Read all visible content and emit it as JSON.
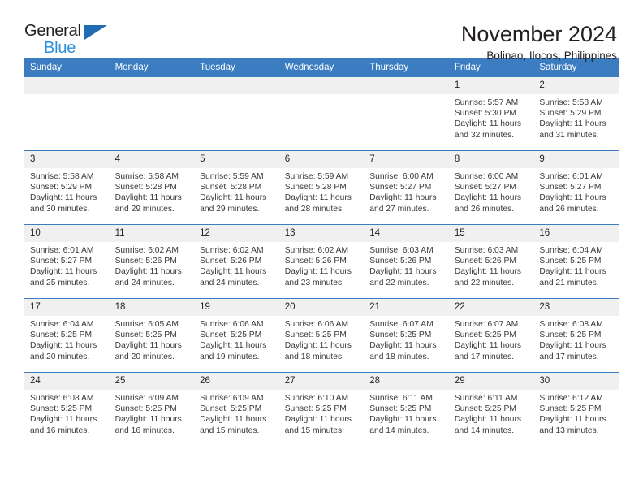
{
  "logo": {
    "line1": "General",
    "line2": "Blue",
    "triangle_icon": "logo-triangle-icon"
  },
  "header": {
    "title": "November 2024",
    "subtitle": "Bolinao, Ilocos, Philippines"
  },
  "colors": {
    "header_blue": "#3b7dc0",
    "logo_blue": "#2e8fd8",
    "daynum_bg": "#f0f0f0",
    "text": "#231f20"
  },
  "labels": {
    "sunrise": "Sunrise:",
    "sunset": "Sunset:",
    "daylight": "Daylight:"
  },
  "weekdays": [
    "Sunday",
    "Monday",
    "Tuesday",
    "Wednesday",
    "Thursday",
    "Friday",
    "Saturday"
  ],
  "weeks": [
    [
      {
        "day": "",
        "empty": true
      },
      {
        "day": "",
        "empty": true
      },
      {
        "day": "",
        "empty": true
      },
      {
        "day": "",
        "empty": true
      },
      {
        "day": "",
        "empty": true
      },
      {
        "day": "1",
        "sunrise": "Sunrise: 5:57 AM",
        "sunset": "Sunset: 5:30 PM",
        "daylight_1": "Daylight: 11 hours",
        "daylight_2": "and 32 minutes."
      },
      {
        "day": "2",
        "sunrise": "Sunrise: 5:58 AM",
        "sunset": "Sunset: 5:29 PM",
        "daylight_1": "Daylight: 11 hours",
        "daylight_2": "and 31 minutes."
      }
    ],
    [
      {
        "day": "3",
        "sunrise": "Sunrise: 5:58 AM",
        "sunset": "Sunset: 5:29 PM",
        "daylight_1": "Daylight: 11 hours",
        "daylight_2": "and 30 minutes."
      },
      {
        "day": "4",
        "sunrise": "Sunrise: 5:58 AM",
        "sunset": "Sunset: 5:28 PM",
        "daylight_1": "Daylight: 11 hours",
        "daylight_2": "and 29 minutes."
      },
      {
        "day": "5",
        "sunrise": "Sunrise: 5:59 AM",
        "sunset": "Sunset: 5:28 PM",
        "daylight_1": "Daylight: 11 hours",
        "daylight_2": "and 29 minutes."
      },
      {
        "day": "6",
        "sunrise": "Sunrise: 5:59 AM",
        "sunset": "Sunset: 5:28 PM",
        "daylight_1": "Daylight: 11 hours",
        "daylight_2": "and 28 minutes."
      },
      {
        "day": "7",
        "sunrise": "Sunrise: 6:00 AM",
        "sunset": "Sunset: 5:27 PM",
        "daylight_1": "Daylight: 11 hours",
        "daylight_2": "and 27 minutes."
      },
      {
        "day": "8",
        "sunrise": "Sunrise: 6:00 AM",
        "sunset": "Sunset: 5:27 PM",
        "daylight_1": "Daylight: 11 hours",
        "daylight_2": "and 26 minutes."
      },
      {
        "day": "9",
        "sunrise": "Sunrise: 6:01 AM",
        "sunset": "Sunset: 5:27 PM",
        "daylight_1": "Daylight: 11 hours",
        "daylight_2": "and 26 minutes."
      }
    ],
    [
      {
        "day": "10",
        "sunrise": "Sunrise: 6:01 AM",
        "sunset": "Sunset: 5:27 PM",
        "daylight_1": "Daylight: 11 hours",
        "daylight_2": "and 25 minutes."
      },
      {
        "day": "11",
        "sunrise": "Sunrise: 6:02 AM",
        "sunset": "Sunset: 5:26 PM",
        "daylight_1": "Daylight: 11 hours",
        "daylight_2": "and 24 minutes."
      },
      {
        "day": "12",
        "sunrise": "Sunrise: 6:02 AM",
        "sunset": "Sunset: 5:26 PM",
        "daylight_1": "Daylight: 11 hours",
        "daylight_2": "and 24 minutes."
      },
      {
        "day": "13",
        "sunrise": "Sunrise: 6:02 AM",
        "sunset": "Sunset: 5:26 PM",
        "daylight_1": "Daylight: 11 hours",
        "daylight_2": "and 23 minutes."
      },
      {
        "day": "14",
        "sunrise": "Sunrise: 6:03 AM",
        "sunset": "Sunset: 5:26 PM",
        "daylight_1": "Daylight: 11 hours",
        "daylight_2": "and 22 minutes."
      },
      {
        "day": "15",
        "sunrise": "Sunrise: 6:03 AM",
        "sunset": "Sunset: 5:26 PM",
        "daylight_1": "Daylight: 11 hours",
        "daylight_2": "and 22 minutes."
      },
      {
        "day": "16",
        "sunrise": "Sunrise: 6:04 AM",
        "sunset": "Sunset: 5:25 PM",
        "daylight_1": "Daylight: 11 hours",
        "daylight_2": "and 21 minutes."
      }
    ],
    [
      {
        "day": "17",
        "sunrise": "Sunrise: 6:04 AM",
        "sunset": "Sunset: 5:25 PM",
        "daylight_1": "Daylight: 11 hours",
        "daylight_2": "and 20 minutes."
      },
      {
        "day": "18",
        "sunrise": "Sunrise: 6:05 AM",
        "sunset": "Sunset: 5:25 PM",
        "daylight_1": "Daylight: 11 hours",
        "daylight_2": "and 20 minutes."
      },
      {
        "day": "19",
        "sunrise": "Sunrise: 6:06 AM",
        "sunset": "Sunset: 5:25 PM",
        "daylight_1": "Daylight: 11 hours",
        "daylight_2": "and 19 minutes."
      },
      {
        "day": "20",
        "sunrise": "Sunrise: 6:06 AM",
        "sunset": "Sunset: 5:25 PM",
        "daylight_1": "Daylight: 11 hours",
        "daylight_2": "and 18 minutes."
      },
      {
        "day": "21",
        "sunrise": "Sunrise: 6:07 AM",
        "sunset": "Sunset: 5:25 PM",
        "daylight_1": "Daylight: 11 hours",
        "daylight_2": "and 18 minutes."
      },
      {
        "day": "22",
        "sunrise": "Sunrise: 6:07 AM",
        "sunset": "Sunset: 5:25 PM",
        "daylight_1": "Daylight: 11 hours",
        "daylight_2": "and 17 minutes."
      },
      {
        "day": "23",
        "sunrise": "Sunrise: 6:08 AM",
        "sunset": "Sunset: 5:25 PM",
        "daylight_1": "Daylight: 11 hours",
        "daylight_2": "and 17 minutes."
      }
    ],
    [
      {
        "day": "24",
        "sunrise": "Sunrise: 6:08 AM",
        "sunset": "Sunset: 5:25 PM",
        "daylight_1": "Daylight: 11 hours",
        "daylight_2": "and 16 minutes."
      },
      {
        "day": "25",
        "sunrise": "Sunrise: 6:09 AM",
        "sunset": "Sunset: 5:25 PM",
        "daylight_1": "Daylight: 11 hours",
        "daylight_2": "and 16 minutes."
      },
      {
        "day": "26",
        "sunrise": "Sunrise: 6:09 AM",
        "sunset": "Sunset: 5:25 PM",
        "daylight_1": "Daylight: 11 hours",
        "daylight_2": "and 15 minutes."
      },
      {
        "day": "27",
        "sunrise": "Sunrise: 6:10 AM",
        "sunset": "Sunset: 5:25 PM",
        "daylight_1": "Daylight: 11 hours",
        "daylight_2": "and 15 minutes."
      },
      {
        "day": "28",
        "sunrise": "Sunrise: 6:11 AM",
        "sunset": "Sunset: 5:25 PM",
        "daylight_1": "Daylight: 11 hours",
        "daylight_2": "and 14 minutes."
      },
      {
        "day": "29",
        "sunrise": "Sunrise: 6:11 AM",
        "sunset": "Sunset: 5:25 PM",
        "daylight_1": "Daylight: 11 hours",
        "daylight_2": "and 14 minutes."
      },
      {
        "day": "30",
        "sunrise": "Sunrise: 6:12 AM",
        "sunset": "Sunset: 5:25 PM",
        "daylight_1": "Daylight: 11 hours",
        "daylight_2": "and 13 minutes."
      }
    ]
  ]
}
